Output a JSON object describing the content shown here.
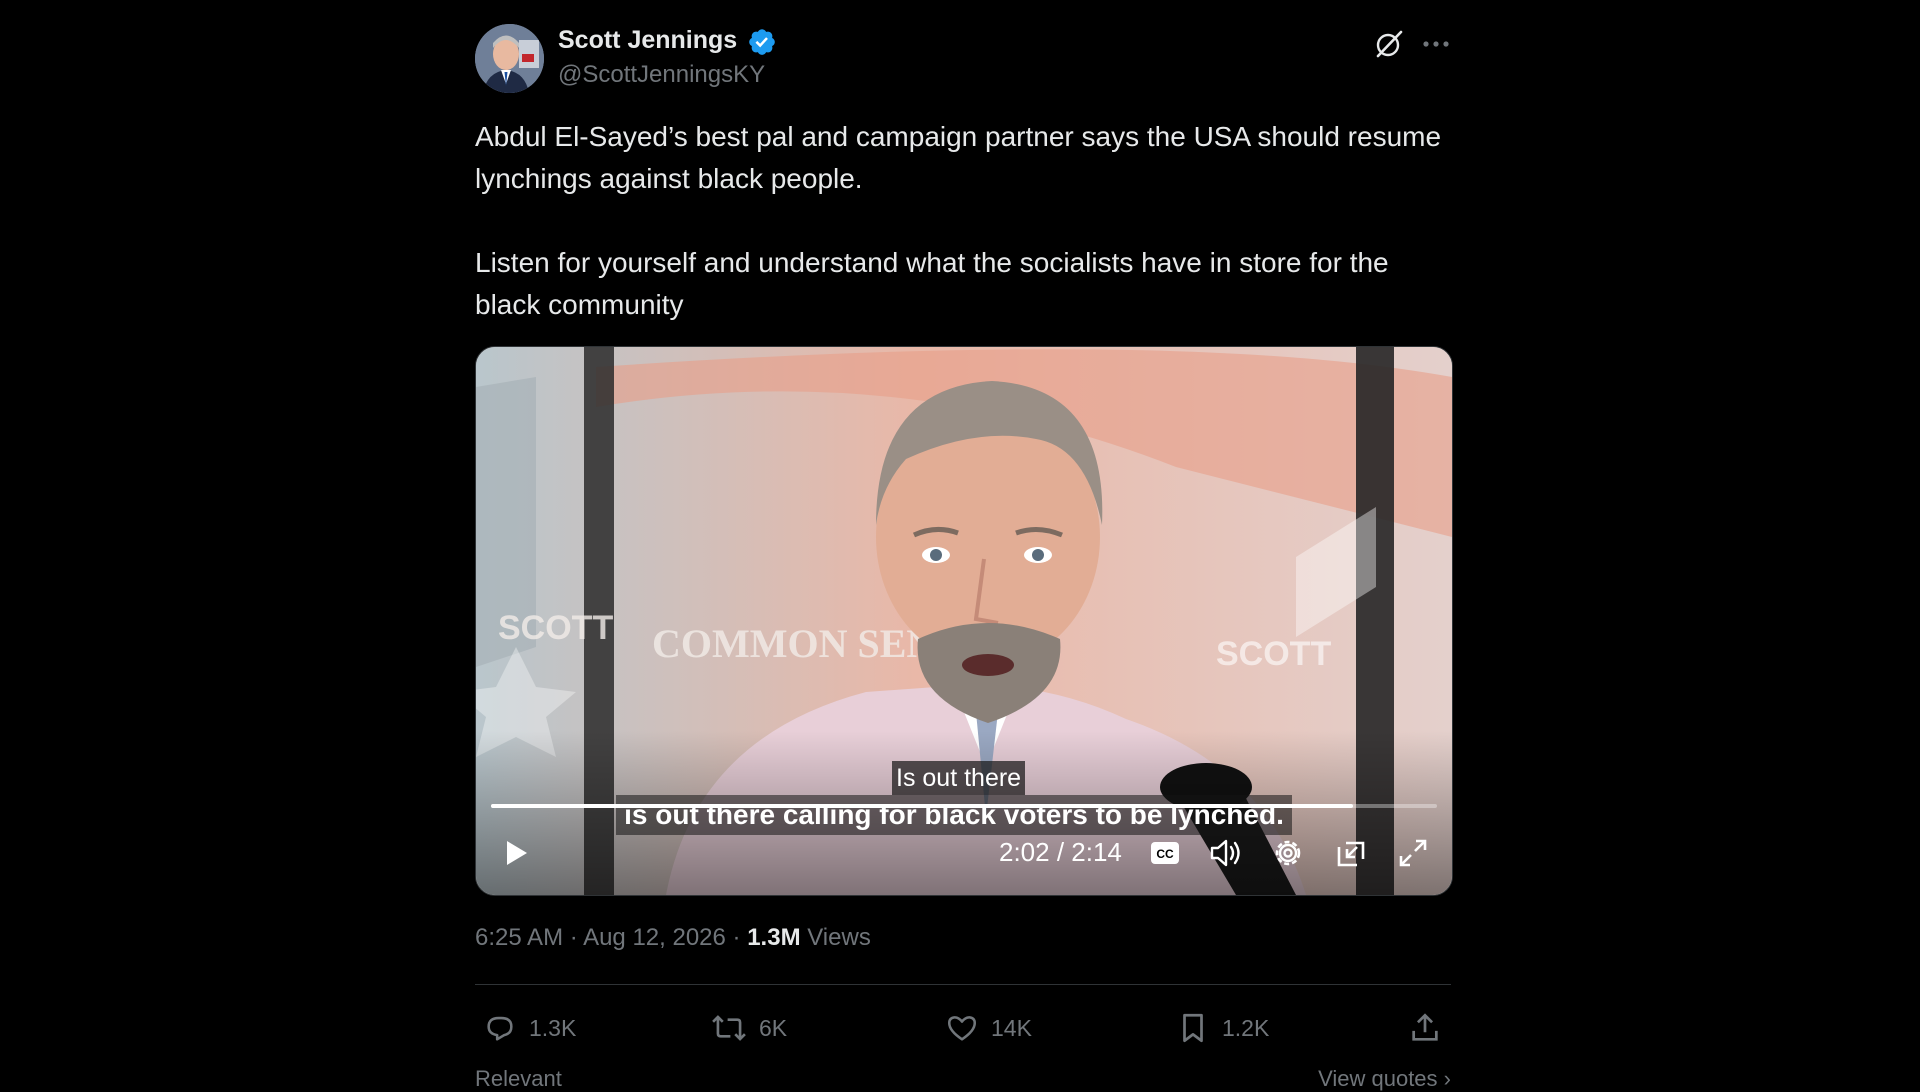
{
  "author": {
    "display_name": "Scott Jennings",
    "handle": "@ScottJenningsKY",
    "verified": true
  },
  "tweet": {
    "paragraphs": [
      "Abdul El-Sayed’s best pal and campaign partner says the USA should resume lynchings against black people.",
      "Listen for yourself and understand what the socialists have in store for the black community"
    ]
  },
  "video": {
    "caption_top": "Is out there",
    "caption_bottom": "is out there calling for black voters to be lynched.",
    "time": "2:02 / 2:14",
    "progress": 0.911,
    "background_signage": [
      "SCOTT JENNINGS",
      "COMMON SENSE",
      "SCOTT JENNINGS"
    ]
  },
  "meta": {
    "time": "6:25 AM",
    "separator": " · ",
    "date": "Aug 12, 2026",
    "views_count": "1.3M",
    "views_label": "Views"
  },
  "actions": {
    "replies": "1.3K",
    "reposts": "6K",
    "likes": "14K",
    "bookmarks": "1.2K"
  },
  "footer": {
    "left": "Relevant",
    "right": "View quotes ›"
  },
  "colors": {
    "background": "#000000",
    "text": "#e7e9ea",
    "muted": "#71767b",
    "verified": "#1d9bf0",
    "divider": "#2f3336"
  },
  "icons": [
    "grok-icon",
    "more-icon",
    "verified-badge-icon",
    "play-icon",
    "closed-captions-icon",
    "volume-icon",
    "settings-icon",
    "pip-icon",
    "fullscreen-icon",
    "reply-icon",
    "repost-icon",
    "like-icon",
    "bookmark-icon",
    "share-icon"
  ]
}
